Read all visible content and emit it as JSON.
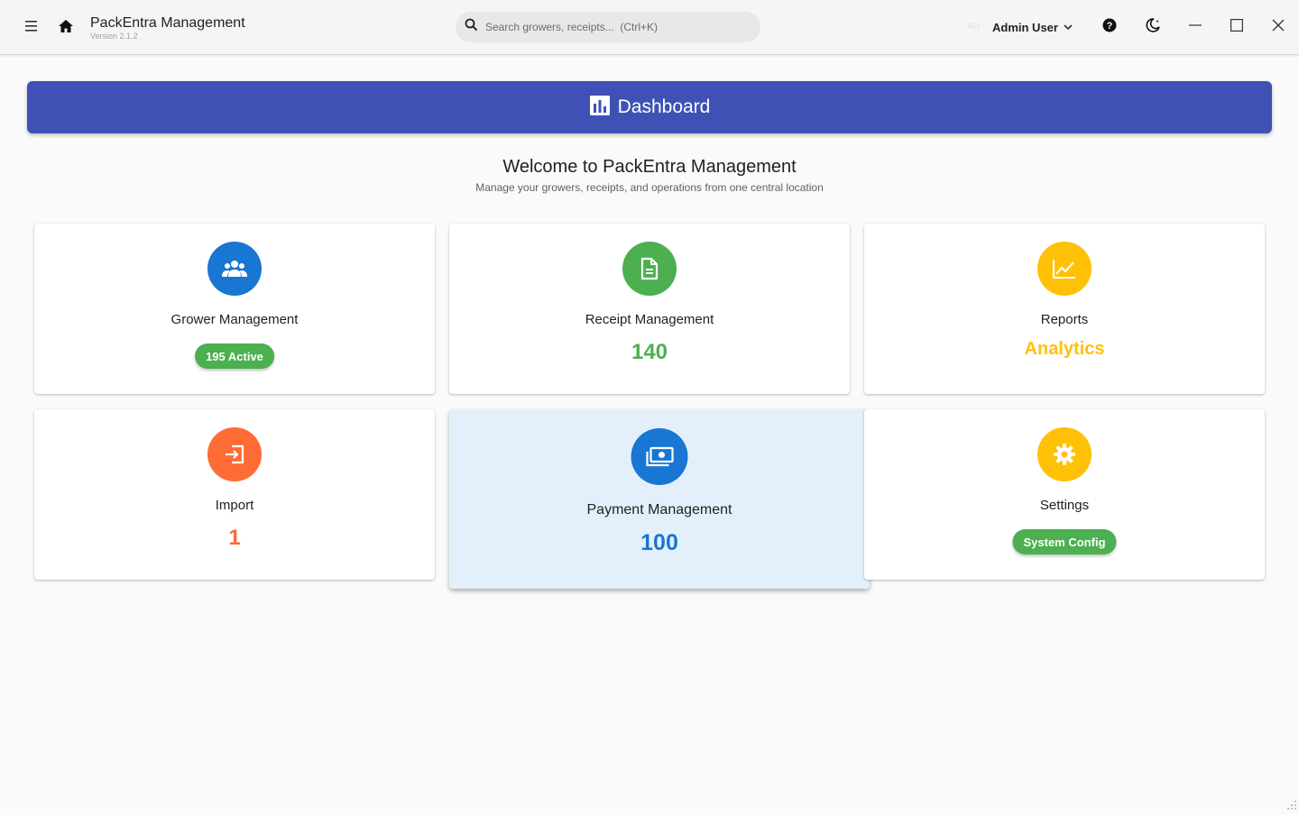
{
  "app": {
    "title": "PackEntra Management",
    "version": "Version 2.1.2"
  },
  "search": {
    "placeholder": "Search growers, receipts...  (Ctrl+K)"
  },
  "user": {
    "initials": "AU",
    "name": "Admin User"
  },
  "icons": {
    "menu": "menu-icon",
    "home": "home-icon",
    "search": "search-icon",
    "user_dropdown": "chevron-down-icon",
    "help": "help-icon",
    "theme": "dark-mode-icon",
    "minimize": "minimize-icon",
    "maximize": "maximize-icon",
    "close": "close-icon",
    "dashboard": "bar-chart-icon"
  },
  "dashboard": {
    "title": "Dashboard",
    "accent": "#3f51b5"
  },
  "welcome": {
    "title": "Welcome to PackEntra Management",
    "subtitle": "Manage your growers, receipts, and operations from one central location"
  },
  "cards": [
    {
      "title": "Grower Management",
      "chip": "195 Active",
      "icon": "people-icon",
      "color": "#1976d2"
    },
    {
      "title": "Receipt Management",
      "value": "140",
      "icon": "document-icon",
      "color": "#4caf50"
    },
    {
      "title": "Reports",
      "value": "Analytics",
      "icon": "line-chart-icon",
      "color": "#ffc107"
    },
    {
      "title": "Import",
      "value": "1",
      "icon": "import-icon",
      "color": "#ff6b35"
    },
    {
      "title": "Payment Management",
      "value": "100",
      "icon": "payment-icon",
      "color": "#1976d2"
    },
    {
      "title": "Settings",
      "chip": "System Config",
      "icon": "gear-icon",
      "color": "#ffc107"
    }
  ],
  "chip_color": "#4caf50"
}
